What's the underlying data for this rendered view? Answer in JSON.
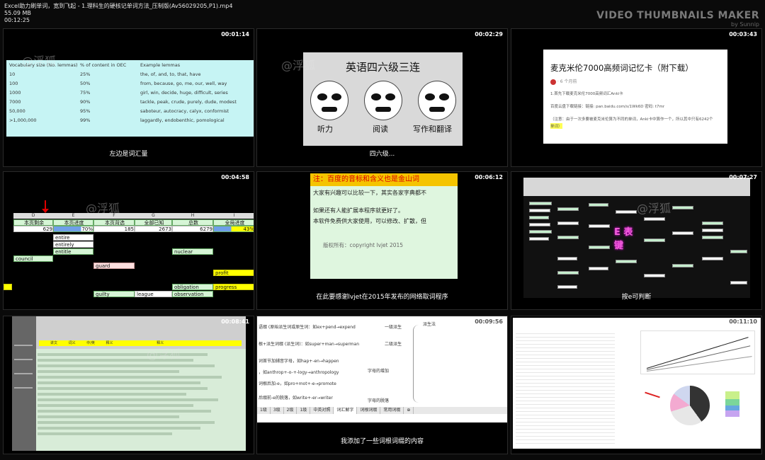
{
  "header": {
    "filename": "Excel助力刷单词，宽到飞起 - 1.理科生的硬核记单词方法_压制版(Av56029205,P1).mp4",
    "filesize": "55.09 MB",
    "duration": "00:12:25"
  },
  "brand": {
    "title": "VIDEO THUMBNAILS MAKER",
    "subtitle": "by Sunnip"
  },
  "watermark": "@浮狐",
  "thumbs": [
    {
      "time": "00:01:14",
      "caption": "左边是词汇量",
      "table": {
        "headers": [
          "Vocabulary size (No. lemmas)",
          "% of content in OEC",
          "Example lemmas"
        ],
        "rows": [
          [
            "10",
            "25%",
            "the, of, and, to, that, have"
          ],
          [
            "100",
            "50%",
            "from, because, go, me, our, well, way"
          ],
          [
            "1000",
            "75%",
            "girl, win, decide, huge, difficult, series"
          ],
          [
            "7000",
            "90%",
            "tackle, peak, crude, purely, dude, modest"
          ],
          [
            "50,000",
            "95%",
            "saboteur, autocracy, calyx, conformist"
          ],
          [
            ">1,000,000",
            "99%",
            "laggardly, endobenthic, pomological"
          ]
        ]
      }
    },
    {
      "time": "00:02:29",
      "caption": "四六级...",
      "title": "英语四六级三连",
      "labels": [
        "听力",
        "阅读",
        "写作和翻译"
      ]
    },
    {
      "time": "00:03:43",
      "caption": "",
      "title": "麦克米伦7000高频词记忆卡（附下载）",
      "author": "· 6 个月前",
      "lines": [
        "1.首先下载麦克米伦7000高频词汇Anki卡",
        "百度云盘下载链接：链接: pan.baidu.com/s/1Wk6D    密码: t7mr",
        "（注意：由于一次多要被麦克米伦算为不同的单词，Anki卡中算作一个，所以其中只有6242个"
      ],
      "highlight": "单词）"
    },
    {
      "time": "00:04:58",
      "caption": "",
      "cols": [
        "D",
        "E",
        "F",
        "G",
        "H",
        "I"
      ],
      "heads": [
        "本页剩余",
        "本页进度",
        "本页背选",
        "全部已知",
        "总数",
        "全局进度"
      ],
      "vals": [
        "629",
        "70%",
        "185",
        "2673",
        "6279",
        "43%"
      ],
      "words": [
        "entire",
        "entirely",
        "entitle",
        "council",
        "nuclear",
        "guard",
        "profit",
        "obligation",
        "progress",
        "guilty",
        "league",
        "observation"
      ]
    },
    {
      "time": "00:06:12",
      "caption": "在此要感谢lvjet在2015年发布的网络取词程序",
      "bar": "注：百度的音标和含义也是金山词",
      "p1": "大家有兴趣可以比较一下，其实各家字典都不",
      "p2": "如果还有人能扩展本程序就更好了。",
      "p3": "本软件免费供大家使用，可以修改、扩散，但",
      "copyright": "版权所有：copyright  lvjet 2015"
    },
    {
      "time": "00:07:27",
      "caption": "按e可判断",
      "label": "E 表 键"
    },
    {
      "time": "00:08:41",
      "caption": "",
      "tabs": [
        "讲文",
        "词义",
        "中/英",
        "释义",
        "释义"
      ]
    },
    {
      "time": "00:09:56",
      "caption": "我添加了一些词根词缀的内容",
      "nodes": [
        "语缀 (原始派生词或原生词：如ex+pend→expend",
        "一级派生",
        "派生法",
        "根+派生词缀 (派生词)：如super+man→superman",
        "二级派生",
        "词首节加辅音字母，如hap+-en→happen",
        "，如anthrop+-o-+-logy→anthropology",
        "词根后加-e，如pro+mot+-e→promote",
        "字母的增加",
        "后缀前-e的脱落，如write+-er→writer",
        "字母的脱落"
      ],
      "tabs": [
        "1级",
        "3级",
        "2级",
        "1级",
        "中英对照",
        "词汇解字",
        "词根词缀",
        "常用词缀"
      ]
    },
    {
      "time": "00:11:10",
      "caption": ""
    }
  ]
}
